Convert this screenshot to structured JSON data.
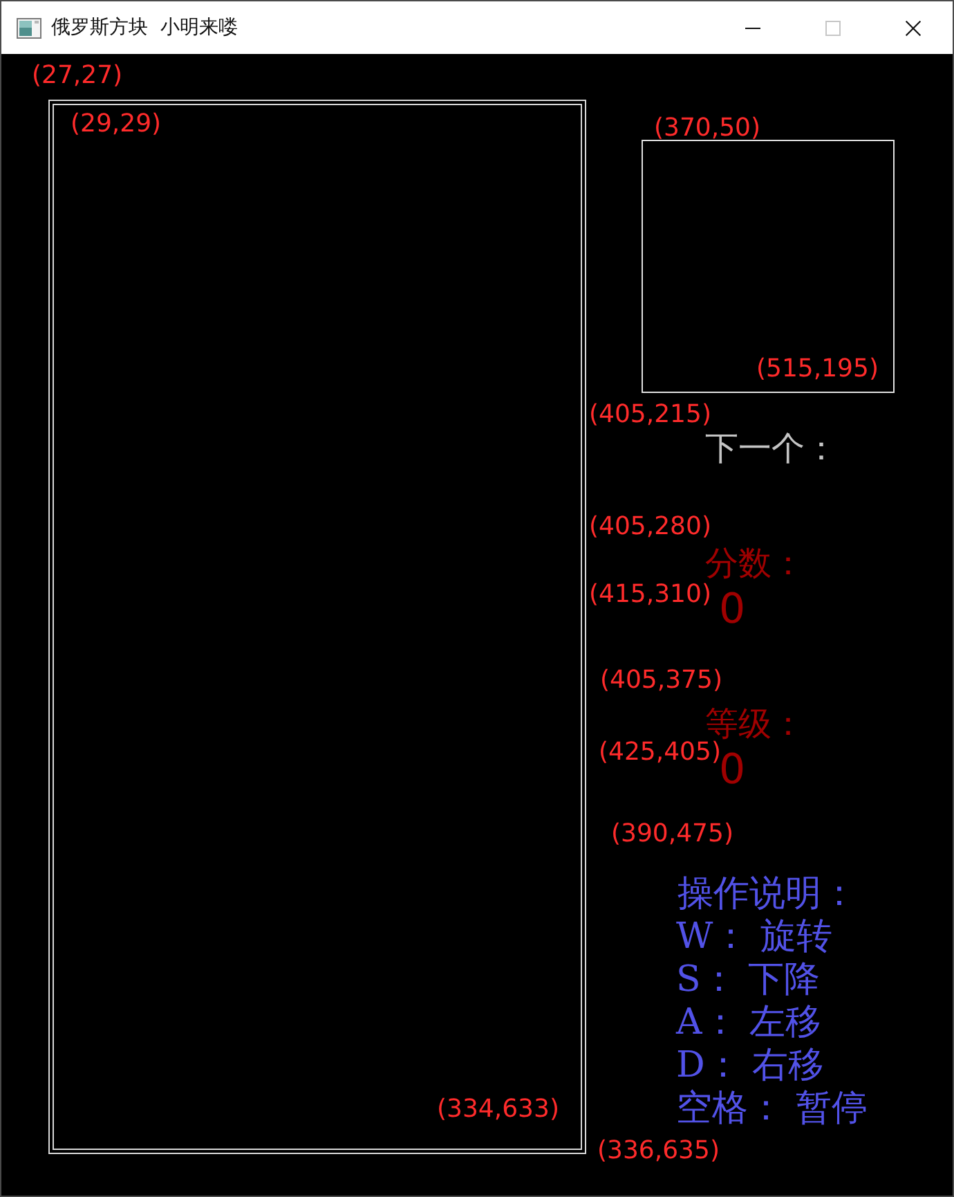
{
  "window": {
    "title": "俄罗斯方块  小明来喽",
    "controls": [
      {
        "kind": "minimize",
        "disabled": false
      },
      {
        "kind": "maximize",
        "disabled": true
      },
      {
        "kind": "close",
        "disabled": false
      }
    ]
  },
  "next_piece": {
    "label": "下一个："
  },
  "score": {
    "label": "分数：",
    "value": "0"
  },
  "grade": {
    "label": "等级：",
    "value": "0"
  },
  "instructions": {
    "title": "操作说明：",
    "lines": [
      "W： 旋转",
      "S： 下降",
      "A： 左移",
      "D： 右移",
      "空格： 暂停"
    ]
  },
  "annotations": [
    "(27,27)",
    "(29,29)",
    "(370,50)",
    "(515,195)",
    "(405,215)",
    "(405,280)",
    "(415,310)",
    "(405,375)",
    "(425,405)",
    "(390,475)",
    "(334,633)",
    "(336,635)"
  ]
}
